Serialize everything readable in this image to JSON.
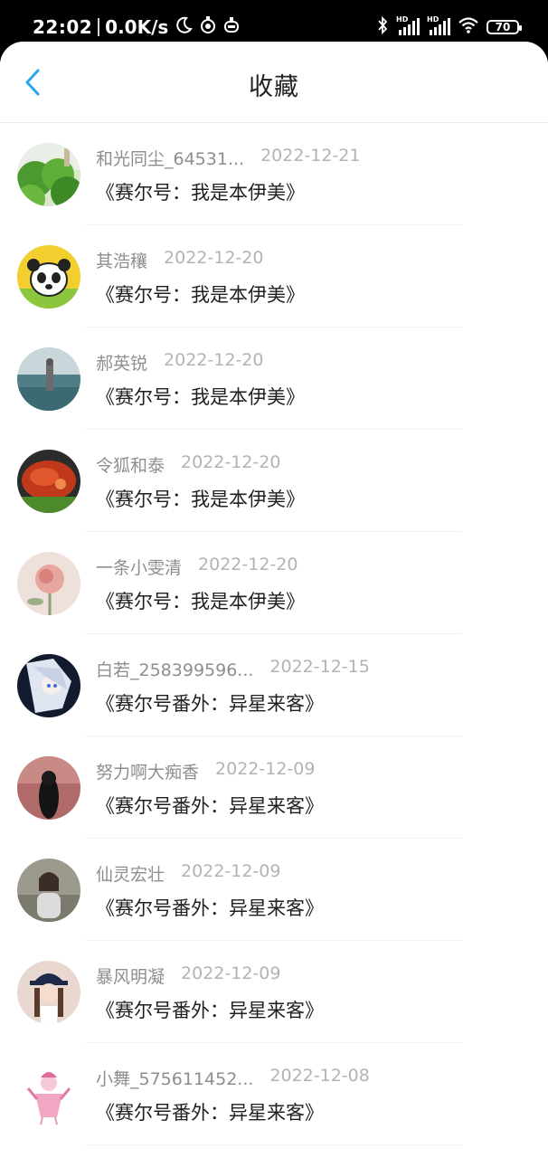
{
  "status_bar": {
    "time": "22:02",
    "net_speed": "0.0K/s",
    "signal1_label": "HD",
    "signal2_label": "HD",
    "battery": "70"
  },
  "header": {
    "title": "收藏",
    "back_icon": "chevron-left-icon"
  },
  "colors": {
    "accent": "#2aa6f0",
    "name": "#8e8e8e",
    "date": "#b3b3b3",
    "work": "#1f1f1f"
  },
  "items": [
    {
      "name": "和光同尘_64531...",
      "date": "2022-12-21",
      "work": "《赛尔号：我是本伊美》",
      "avatar": "greenery"
    },
    {
      "name": "其浩穰",
      "date": "2022-12-20",
      "work": "《赛尔号：我是本伊美》",
      "avatar": "panda"
    },
    {
      "name": "郝英锐",
      "date": "2022-12-20",
      "work": "《赛尔号：我是本伊美》",
      "avatar": "lake"
    },
    {
      "name": "令狐和泰",
      "date": "2022-12-20",
      "work": "《赛尔号：我是本伊美》",
      "avatar": "food"
    },
    {
      "name": "一条小雯清",
      "date": "2022-12-20",
      "work": "《赛尔号：我是本伊美》",
      "avatar": "flower"
    },
    {
      "name": "白若_258399596...",
      "date": "2022-12-15",
      "work": "《赛尔号番外：异星来客》",
      "avatar": "anime-dark"
    },
    {
      "name": "努力啊大痴香",
      "date": "2022-12-09",
      "work": "《赛尔号番外：异星来客》",
      "avatar": "silhouette"
    },
    {
      "name": "仙灵宏壮",
      "date": "2022-12-09",
      "work": "《赛尔号番外：异星来客》",
      "avatar": "girl-field"
    },
    {
      "name": "暴风明凝",
      "date": "2022-12-09",
      "work": "《赛尔号番外：异星来客》",
      "avatar": "girl-cap"
    },
    {
      "name": "小舞_575611452...",
      "date": "2022-12-08",
      "work": "《赛尔号番外：异星来客》",
      "avatar": "anime-pink"
    }
  ]
}
